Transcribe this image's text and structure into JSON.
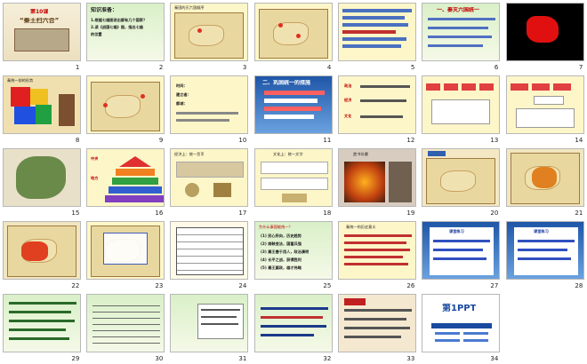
{
  "slides": [
    {
      "num": "1",
      "title": "第10课",
      "subtitle": "“秦王扫六合”"
    },
    {
      "num": "2",
      "title": "知识准备：",
      "lines": [
        "1.根据七雄图说出都有几个国家？",
        "2.读《战国七雄》图，指出七雄",
        "的位置"
      ]
    },
    {
      "num": "3",
      "title": "秦国的灭六国顺序"
    },
    {
      "num": "4"
    },
    {
      "num": "5"
    },
    {
      "num": "6",
      "title": "一、秦灭六国统一"
    },
    {
      "num": "7"
    },
    {
      "num": "8",
      "title": "秦统一前的形势"
    },
    {
      "num": "9"
    },
    {
      "num": "10",
      "lines": [
        "时间：",
        "建立者：",
        "都城："
      ]
    },
    {
      "num": "11",
      "title": "二、巩固统一的措施"
    },
    {
      "num": "12",
      "lines": [
        "政治",
        "经济",
        "文化"
      ]
    },
    {
      "num": "13"
    },
    {
      "num": "14"
    },
    {
      "num": "15"
    },
    {
      "num": "16",
      "lines": [
        "中央",
        "地方"
      ]
    },
    {
      "num": "17",
      "title": "经济上：统一货币"
    },
    {
      "num": "18",
      "title": "文化上：统一文字"
    },
    {
      "num": "19",
      "title": "焚书坑儒"
    },
    {
      "num": "20"
    },
    {
      "num": "21"
    },
    {
      "num": "22"
    },
    {
      "num": "23"
    },
    {
      "num": "24"
    },
    {
      "num": "25",
      "title": "为什么秦国能统一？",
      "lines": [
        "(1) 民心所向，历史趋势",
        "(2) 商鞅变法，国富兵强",
        "(3) 秦王善于用人，政治清明",
        "(4) 长平之战，获得胜利",
        "(5) 秦王嬴政，雄才伟略"
      ]
    },
    {
      "num": "26",
      "title": "秦统一的历史意义"
    },
    {
      "num": "27",
      "title": "课堂练习"
    },
    {
      "num": "28",
      "title": "课堂练习"
    },
    {
      "num": "29"
    },
    {
      "num": "30"
    },
    {
      "num": "31"
    },
    {
      "num": "32"
    },
    {
      "num": "33"
    },
    {
      "num": "34",
      "title": "第1PPT"
    }
  ]
}
